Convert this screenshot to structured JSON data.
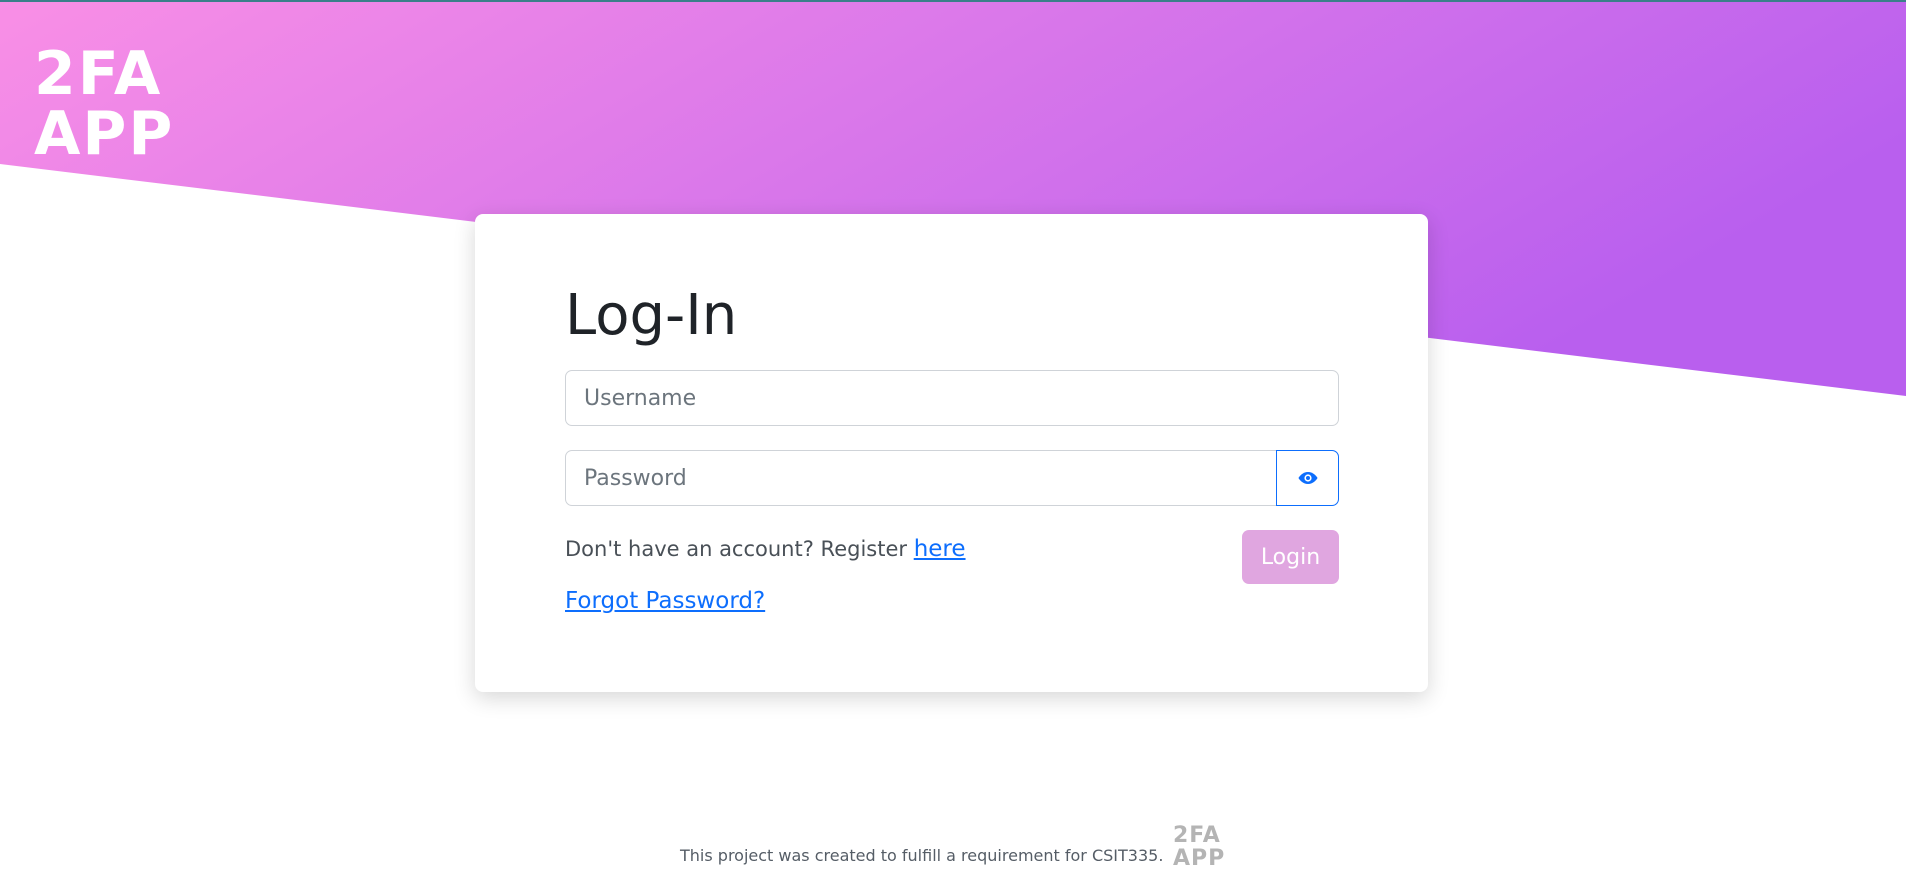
{
  "colors": {
    "gradient_start": "#f98fe6",
    "gradient_end": "#b95fee",
    "primary": "#0d6efd",
    "login_button": "#e0a6e0"
  },
  "brand": {
    "logo_line1": "2FA",
    "logo_line2": "APP"
  },
  "login_form": {
    "title": "Log-In",
    "username_placeholder": "Username",
    "password_placeholder": "Password",
    "toggle_icon": "eye-icon",
    "register_prompt": "Don't have an account? Register",
    "register_link": "here",
    "forgot_password_link": "Forgot Password?",
    "login_button": "Login"
  },
  "footer": {
    "text": "This project was created to fulfill a requirement for CSIT335."
  }
}
